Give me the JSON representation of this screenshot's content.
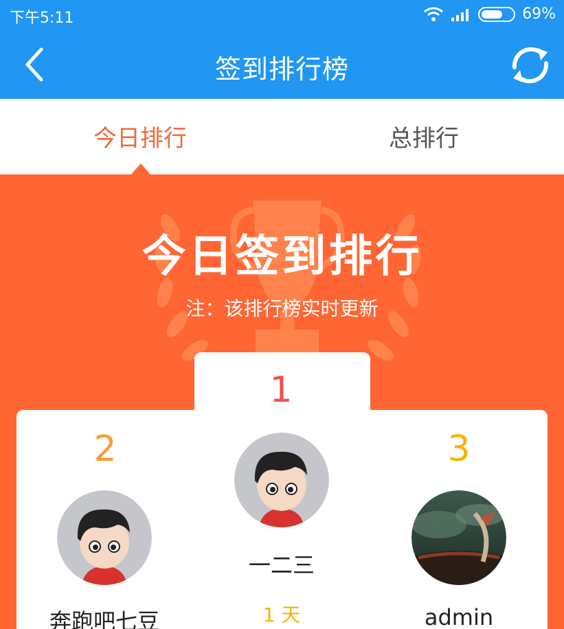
{
  "status_bar": {
    "time": "下午5:11",
    "battery_percent": "69%",
    "battery_level": 0.69
  },
  "app_bar": {
    "title": "签到排行榜",
    "back_icon": "chevron-left-icon",
    "refresh_icon": "refresh-icon"
  },
  "tabs": [
    {
      "label": "今日排行",
      "active": true
    },
    {
      "label": "总排行",
      "active": false
    }
  ],
  "banner": {
    "title": "今日签到排行",
    "note": "注：该排行榜实时更新"
  },
  "ranking": [
    {
      "rank": "1",
      "name": "一二三",
      "days": "1 天",
      "avatar": "cartoon-boy-avatar"
    },
    {
      "rank": "2",
      "name": "奔跑吧七豆",
      "avatar": "cartoon-boy-avatar"
    },
    {
      "rank": "3",
      "name": "admin",
      "avatar": "landscape-photo-avatar"
    }
  ],
  "colors": {
    "primary": "#2196f3",
    "accent": "#ff6633",
    "tab_active": "#ef6c3a",
    "rank_1": "#ef5350",
    "rank_2": "#ff9933",
    "rank_3": "#f5b400"
  }
}
